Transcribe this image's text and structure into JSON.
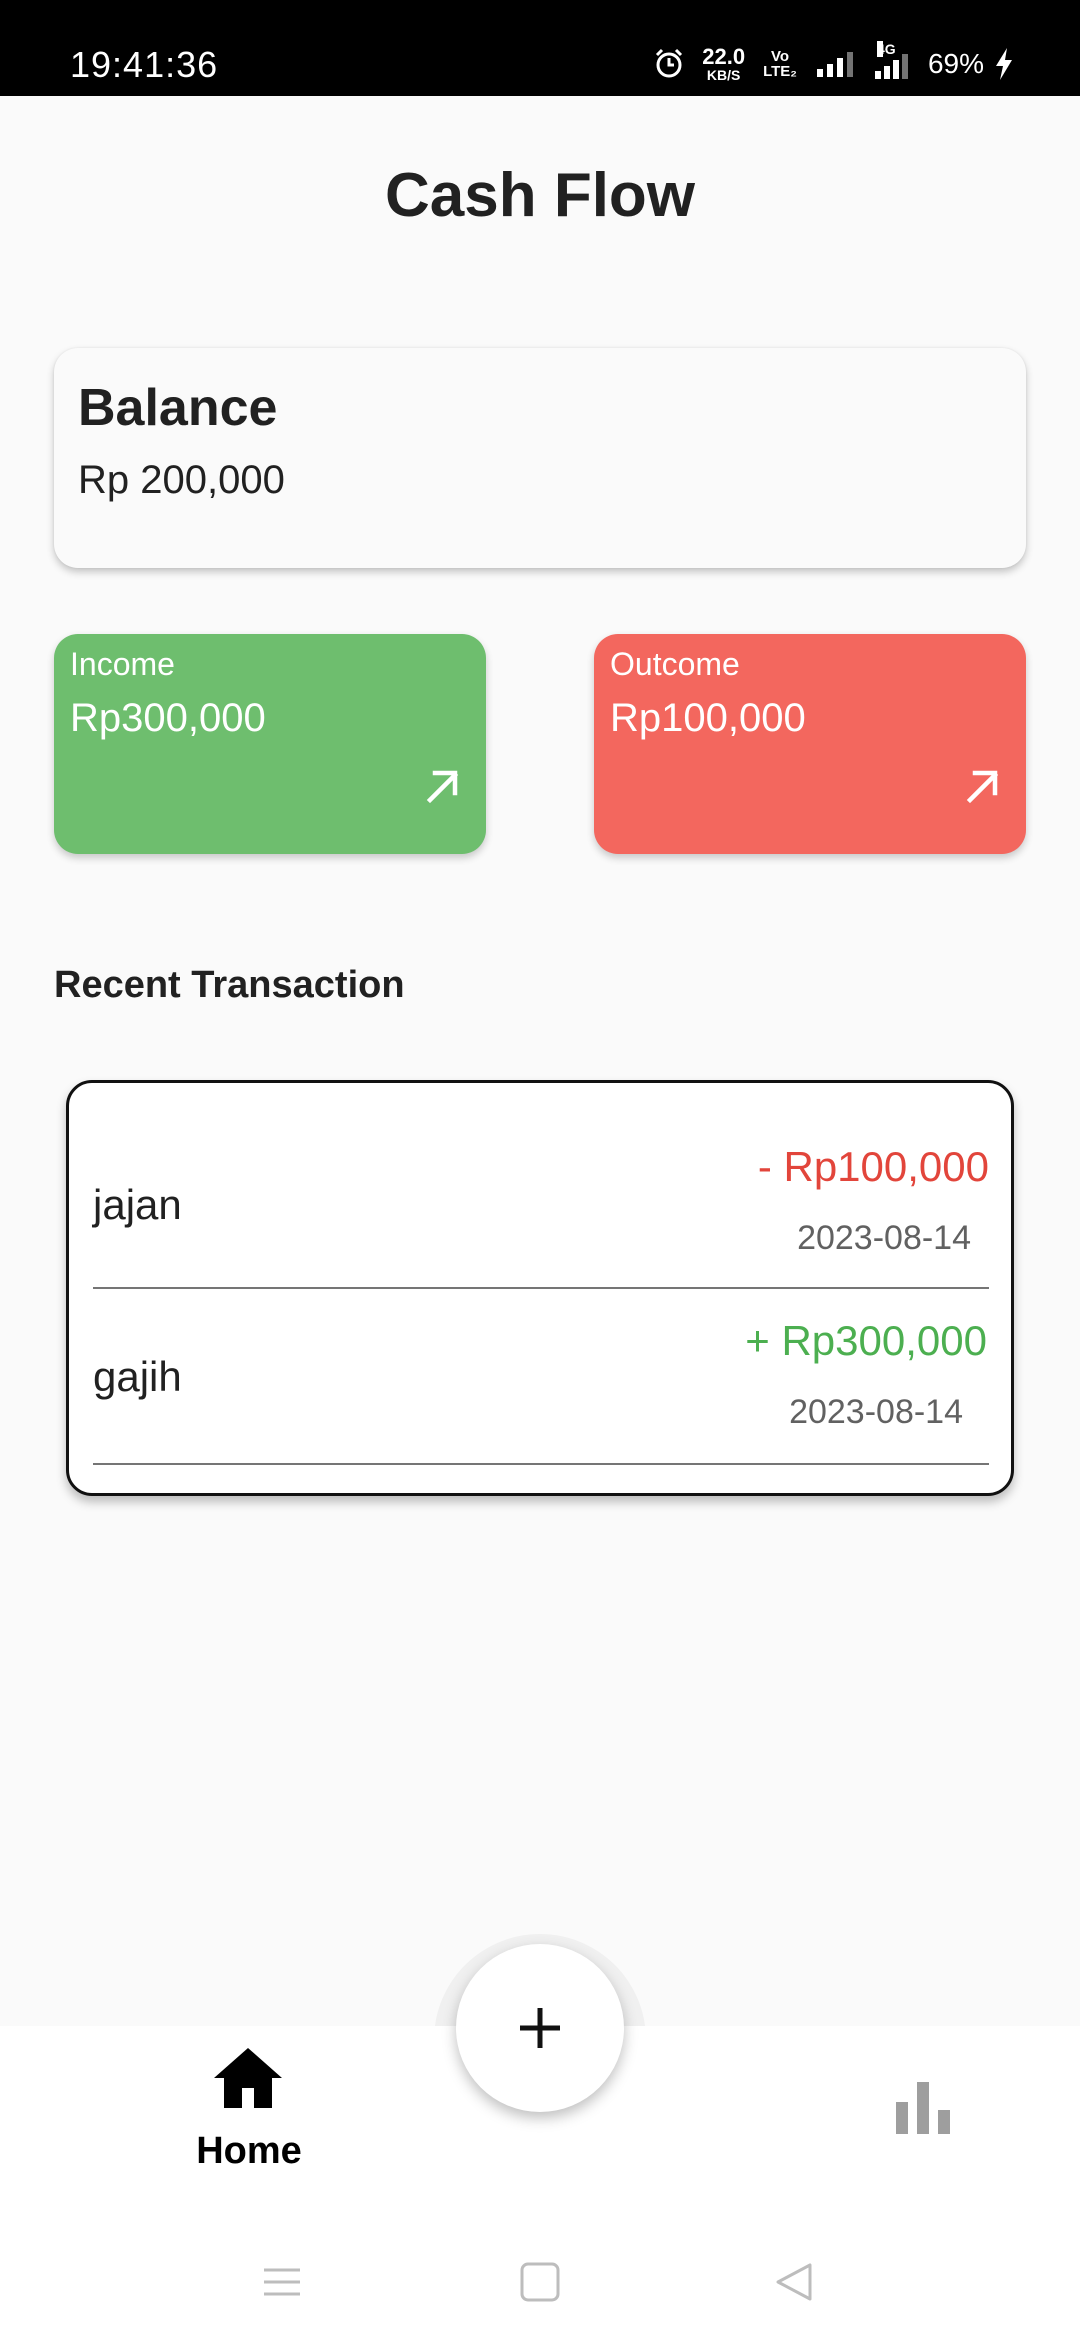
{
  "status_bar": {
    "time": "19:41:36",
    "net_speed_value": "22.0",
    "net_speed_unit": "KB/S",
    "volte_top": "Vo",
    "volte_bottom": "LTE₂",
    "network_label": "4G",
    "battery": "69%"
  },
  "page": {
    "title": "Cash Flow"
  },
  "balance": {
    "title": "Balance",
    "value": "Rp 200,000"
  },
  "income": {
    "label": "Income",
    "value": "Rp300,000",
    "color": "#6ebe6e"
  },
  "outcome": {
    "label": "Outcome",
    "value": "Rp100,000",
    "color": "#f3675e"
  },
  "recent": {
    "title": "Recent Transaction",
    "transactions": [
      {
        "name": "jajan",
        "amount": "- Rp100,000",
        "date": "2023-08-14",
        "type": "outcome",
        "color": "#e2453b"
      },
      {
        "name": "gajih",
        "amount": "+ Rp300,000",
        "date": "2023-08-14",
        "type": "income",
        "color": "#4caf50"
      }
    ]
  },
  "bottom_nav": {
    "home_label": "Home",
    "home_icon": "home-icon",
    "add_icon": "plus-icon",
    "stats_icon": "bar-chart-icon"
  },
  "system_nav": {
    "icons": [
      "menu-icon",
      "square-home-icon",
      "back-triangle-icon"
    ]
  }
}
